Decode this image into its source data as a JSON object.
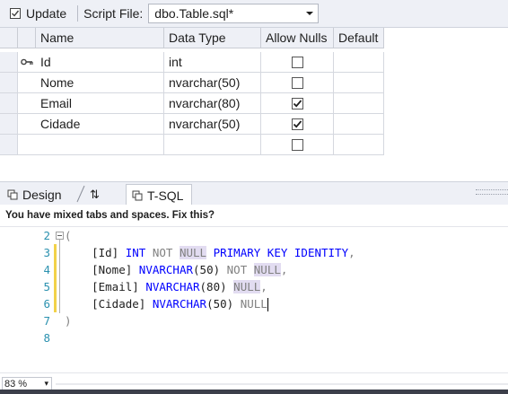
{
  "toolbar": {
    "update_label": "Update",
    "script_file_label": "Script File:",
    "script_file_value": "dbo.Table.sql*"
  },
  "grid": {
    "columns": [
      "Name",
      "Data Type",
      "Allow Nulls",
      "Default"
    ],
    "rows": [
      {
        "name": "Id",
        "data_type": "int",
        "allow_nulls": false,
        "default": "",
        "primary_key": true
      },
      {
        "name": "Nome",
        "data_type": "nvarchar(50)",
        "allow_nulls": false,
        "default": ""
      },
      {
        "name": "Email",
        "data_type": "nvarchar(80)",
        "allow_nulls": true,
        "default": ""
      },
      {
        "name": "Cidade",
        "data_type": "nvarchar(50)",
        "allow_nulls": true,
        "default": ""
      },
      {
        "name": "",
        "data_type": "",
        "allow_nulls": false,
        "default": ""
      }
    ]
  },
  "tabs": {
    "design": "Design",
    "swap": "⇅",
    "tsql": "T-SQL"
  },
  "infobar": {
    "message": "You have mixed tabs and spaces. Fix this?"
  },
  "editor": {
    "line_numbers": [
      "2",
      "3",
      "4",
      "5",
      "6",
      "7",
      "8"
    ],
    "lines": {
      "l2": "(",
      "l3_a": "    [Id] ",
      "l3_b": "INT",
      "l3_c": "NOT",
      "l3_d": "NULL",
      "l3_e": "PRIMARY KEY IDENTITY",
      "l3_f": ",",
      "l4_a": "    [Nome] ",
      "l4_b": "NVARCHAR",
      "l4_c": "(50) ",
      "l4_d": "NOT",
      "l4_e": "NULL",
      "l4_f": ",",
      "l5_a": "    [Email] ",
      "l5_b": "NVARCHAR",
      "l5_c": "(80) ",
      "l5_d": "NULL",
      "l5_e": ",",
      "l6_a": "    [Cidade] ",
      "l6_b": "NVARCHAR",
      "l6_c": "(50) ",
      "l6_d": "NULL",
      "l7": ")"
    }
  },
  "status": {
    "zoom": "83 %"
  },
  "colors": {
    "keyword": "#0000ff",
    "gray_keyword": "#808080",
    "line_number": "#2b91af",
    "change_marker": "#f2d249"
  }
}
